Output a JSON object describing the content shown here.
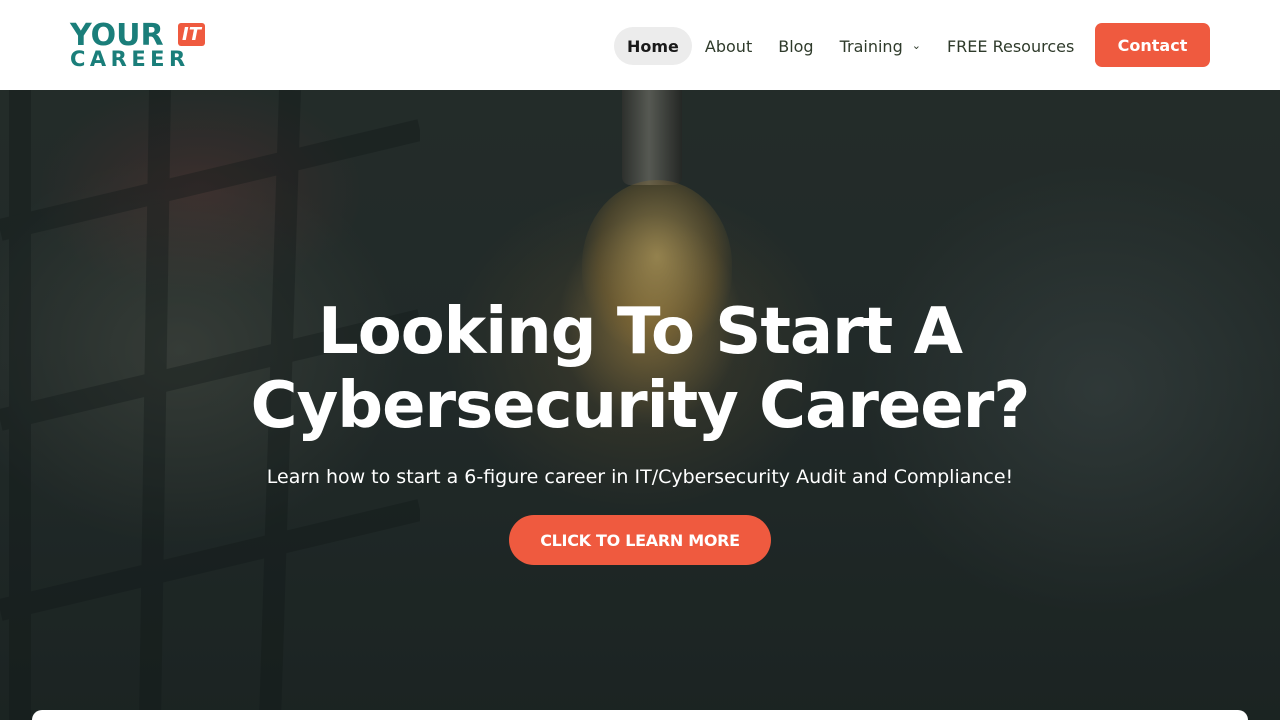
{
  "logo": {
    "your": "YOUR",
    "it": "IT",
    "career": "CAREER"
  },
  "nav": {
    "items": [
      {
        "label": "Home",
        "active": true
      },
      {
        "label": "About"
      },
      {
        "label": "Blog"
      },
      {
        "label": "Training",
        "has_dropdown": true
      },
      {
        "label": "FREE Resources"
      }
    ],
    "contact_label": "Contact"
  },
  "hero": {
    "title_line1": "Looking To Start A",
    "title_line2": "Cybersecurity Career?",
    "subtitle": "Learn how to start a 6-figure career in IT/Cybersecurity Audit and Compliance!",
    "cta_label": "CLICK TO LEARN MORE"
  },
  "colors": {
    "brand_teal": "#1a7e7a",
    "accent_orange": "#ef5a3f"
  }
}
